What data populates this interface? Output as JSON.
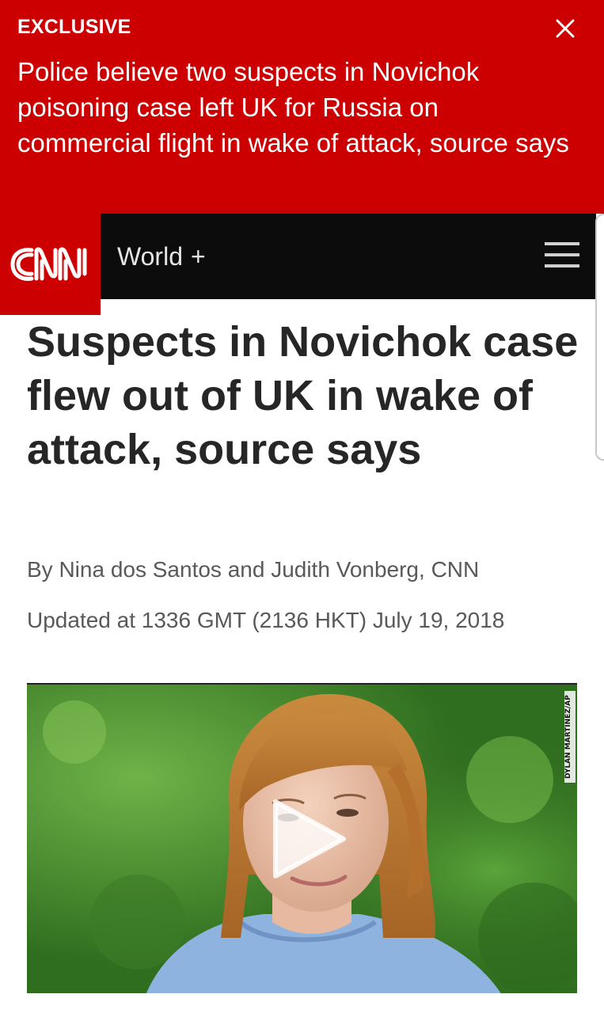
{
  "banner": {
    "label": "EXCLUSIVE",
    "text": "Police believe two suspects in Novichok poisoning case left UK for Russia on commercial flight in wake of attack, source says",
    "color": "#cc0000"
  },
  "nav": {
    "logo_text": "CNN",
    "section": "World",
    "section_expand": "+"
  },
  "article": {
    "headline": "Suspects in Novichok case flew out of UK in wake of attack, source says",
    "byline": "By Nina dos Santos and Judith Vonberg, CNN",
    "updated": "Updated at 1336 GMT (2136 HKT) July 19, 2018"
  },
  "video": {
    "photo_credit": "DYLAN MARTINEZ/AP"
  },
  "colors": {
    "brand_red": "#cc0000",
    "nav_bg": "#0c0c0c",
    "headline": "#262626",
    "meta": "#595959"
  }
}
